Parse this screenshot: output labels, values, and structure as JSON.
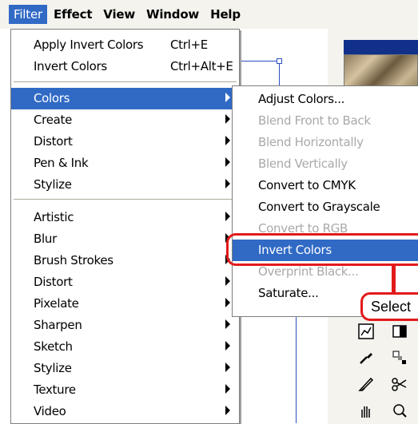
{
  "menubar": {
    "items": [
      {
        "label": "Filter",
        "active": true
      },
      {
        "label": "Effect",
        "active": false
      },
      {
        "label": "View",
        "active": false
      },
      {
        "label": "Window",
        "active": false
      },
      {
        "label": "Help",
        "active": false
      }
    ]
  },
  "filter_menu": {
    "recent": [
      {
        "label": "Apply Invert Colors",
        "shortcut": "Ctrl+E"
      },
      {
        "label": "Invert Colors",
        "shortcut": "Ctrl+Alt+E"
      }
    ],
    "group1": [
      "Colors",
      "Create",
      "Distort",
      "Pen & Ink",
      "Stylize"
    ],
    "group2": [
      "Artistic",
      "Blur",
      "Brush Strokes",
      "Distort",
      "Pixelate",
      "Sharpen",
      "Sketch",
      "Stylize",
      "Texture",
      "Video"
    ],
    "highlighted": "Colors"
  },
  "colors_submenu": {
    "items": [
      {
        "label": "Adjust Colors...",
        "enabled": true
      },
      {
        "label": "Blend Front to Back",
        "enabled": false
      },
      {
        "label": "Blend Horizontally",
        "enabled": false
      },
      {
        "label": "Blend Vertically",
        "enabled": false
      },
      {
        "label": "Convert to CMYK",
        "enabled": true
      },
      {
        "label": "Convert to Grayscale",
        "enabled": true
      },
      {
        "label": "Convert to RGB",
        "enabled": false
      },
      {
        "label": "Invert Colors",
        "enabled": true,
        "highlighted": true
      },
      {
        "label": "Overprint Black...",
        "enabled": false
      },
      {
        "label": "Saturate...",
        "enabled": true
      }
    ]
  },
  "callout": {
    "text": "Select"
  },
  "colors": {
    "highlight": "#316ac5",
    "callout": "#e21a1a",
    "menubar": "#f4f3ee"
  }
}
